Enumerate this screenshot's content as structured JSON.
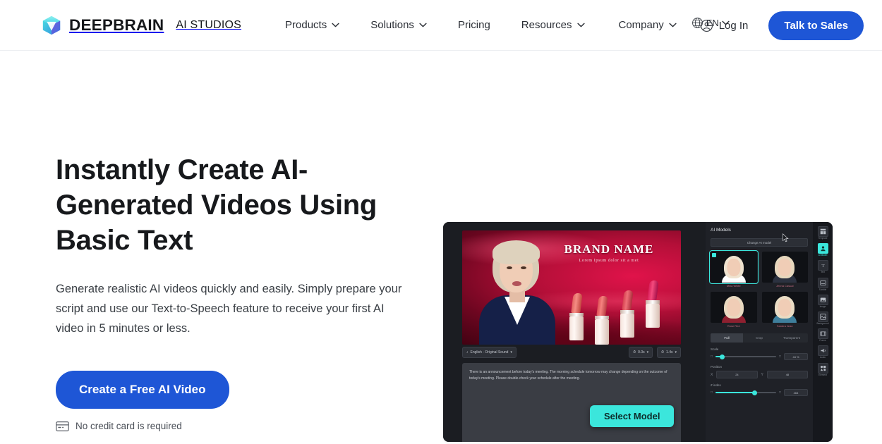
{
  "header": {
    "logo_icon": "cube-gem-icon",
    "brand_name": "DEEPBRAIN",
    "brand_sub": "AI STUDIOS",
    "nav": [
      {
        "label": "Products",
        "has_dropdown": true
      },
      {
        "label": "Solutions",
        "has_dropdown": true
      },
      {
        "label": "Pricing",
        "has_dropdown": false
      },
      {
        "label": "Resources",
        "has_dropdown": true
      },
      {
        "label": "Company",
        "has_dropdown": true
      }
    ],
    "language": {
      "icon": "globe-icon",
      "label": "EN"
    },
    "login": {
      "icon": "user-circle-icon",
      "label": "Log In"
    },
    "cta": "Talk to Sales"
  },
  "hero": {
    "headline": "Instantly Create AI-Generated Videos Using Basic Text",
    "subhead": "Generate realistic AI videos quickly and easily. Simply prepare your script and use our Text-to-Speech feature to receive your first AI video in 5 minutes or less.",
    "cta": "Create a Free AI Video",
    "note": "No credit card is required",
    "note_icon": "credit-card-icon"
  },
  "mockup": {
    "canvas": {
      "brand_title": "BRAND NAME",
      "brand_sub": "Lorem Ipsum dolor sit a met"
    },
    "toolbar": {
      "voice_chip": "English - Original Sound",
      "time_chip_1": "0.0s",
      "time_chip_2": "1.4s"
    },
    "script_text": "There is an announcement before today's meeting. The morning schedule tomorrow may change depending on the outcome of today's meeting. Please double-check your schedule after the meeting.",
    "select_model_button": "Select Model",
    "panel": {
      "title": "AI Models",
      "change_button": "Change AI model",
      "models": [
        {
          "name": "Mina White",
          "selected": true,
          "hair": "#efe3cf",
          "body": "#ffffff"
        },
        {
          "name": "Jenna Casual",
          "selected": false,
          "hair": "#e6d7bd",
          "body": "#2c3240"
        },
        {
          "name": "Rose Red",
          "selected": false,
          "hair": "#e8d9c0",
          "body": "#8e2030"
        },
        {
          "name": "Sandra Jean",
          "selected": false,
          "hair": "#e9dcc4",
          "body": "#3f7f9c"
        }
      ],
      "tabs": [
        {
          "label": "Full",
          "active": true
        },
        {
          "label": "Crop",
          "active": false
        },
        {
          "label": "Transparent",
          "active": false
        }
      ],
      "controls": [
        {
          "label": "Scale",
          "type": "slider",
          "percent": 8,
          "value": "44 %"
        },
        {
          "label": "Position",
          "type": "pair",
          "x": "24",
          "y": "48"
        },
        {
          "label": "Z index",
          "type": "slider",
          "percent": 62,
          "value": "464"
        }
      ]
    },
    "rail": [
      {
        "label": "Template",
        "icon": "template-icon",
        "active": false
      },
      {
        "label": "AI Model",
        "icon": "ai-model-icon",
        "active": true
      },
      {
        "label": "Text",
        "icon": "text-icon",
        "active": false
      },
      {
        "label": "Subtitle",
        "icon": "subtitle-icon",
        "active": false
      },
      {
        "label": "Image",
        "icon": "image-icon",
        "active": false
      },
      {
        "label": "Background",
        "icon": "background-icon",
        "active": false
      },
      {
        "label": "Frame",
        "icon": "frame-icon",
        "active": false
      },
      {
        "label": "Audio",
        "icon": "audio-icon",
        "active": false
      },
      {
        "label": "Element",
        "icon": "element-icon",
        "active": false
      }
    ]
  },
  "colors": {
    "primary_blue": "#1E56D6",
    "accent_teal": "#3BE6DC",
    "text_dark": "#17191c"
  }
}
